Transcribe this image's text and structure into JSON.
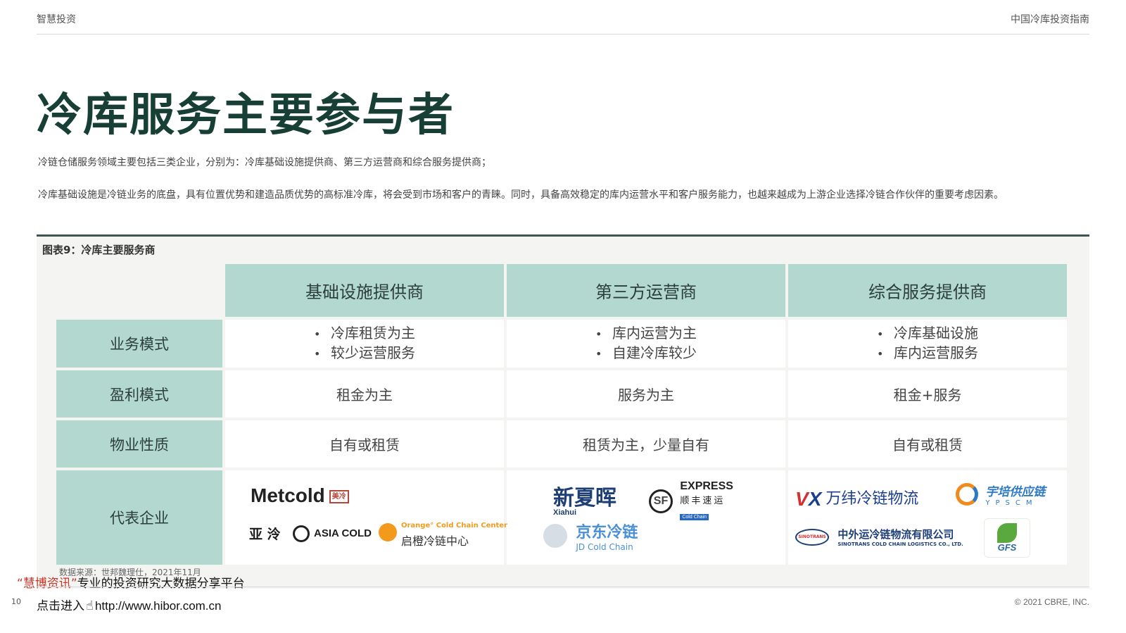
{
  "header": {
    "left": "智慧投资",
    "right": "中国冷库投资指南"
  },
  "title": "冷库服务主要参与者",
  "intro": {
    "p1": "冷链仓储服务领域主要包括三类企业，分别为：冷库基础设施提供商、第三方运营商和综合服务提供商；",
    "p2": "冷库基础设施是冷链业务的底盘，具有位置优势和建造品质优势的高标准冷库，将会受到市场和客户的青睐。同时，具备高效稳定的库内运营水平和客户服务能力，也越来越成为上游企业选择冷链合作伙伴的重要考虑因素。"
  },
  "figure": {
    "caption": "图表9：冷库主要服务商",
    "columns": [
      "基础设施提供商",
      "第三方运营商",
      "综合服务提供商"
    ],
    "rows": [
      {
        "label": "业务模式",
        "cells": [
          [
            "冷库租赁为主",
            "较少运营服务"
          ],
          [
            "库内运营为主",
            "自建冷库较少"
          ],
          [
            "冷库基础设施",
            "库内运营服务"
          ]
        ]
      },
      {
        "label": "盈利模式",
        "cells": [
          "租金为主",
          "服务为主",
          "租金+服务"
        ]
      },
      {
        "label": "物业性质",
        "cells": [
          "自有或租赁",
          "租赁为主，少量自有",
          "自有或租赁"
        ]
      },
      {
        "label": "代表企业"
      }
    ],
    "logos": {
      "metcold": {
        "name": "Metcold",
        "seal": "美冷"
      },
      "yaleng": {
        "name": "亚 泠"
      },
      "asiacold": {
        "name": "ASIA COLD"
      },
      "orange": {
        "en": "Orange° Cold Chain Center",
        "zh": "启橙冷链中心"
      },
      "xiahui": {
        "name": "新夏晖",
        "sub": "Xiahui"
      },
      "sf": {
        "mark": "SF",
        "en": "EXPRESS",
        "zh": "顺丰速运",
        "badge": "Cold Chain"
      },
      "jd": {
        "zh": "京东冷链",
        "en": "JD Cold Chain"
      },
      "vx": {
        "mark_v": "V",
        "mark_x": "X",
        "zh": "万纬冷链物流"
      },
      "ypscm": {
        "zh": "宇培供应链",
        "en": "YPSCM"
      },
      "sinotrans": {
        "mark": "SINOTRANS",
        "zh": "中外运冷链物流有限公司",
        "en": "SINOTRANS COLD CHAIN LOGISTICS CO., LTD."
      },
      "gfs": {
        "name": "GFS"
      }
    },
    "source": "数据来源：世邦魏理仕，2021年11月"
  },
  "watermark": {
    "brand": "慧博资讯",
    "slogan": "专业的投资研究大数据分享平台",
    "click": "点击进入",
    "url": "http://www.hibor.com.cn"
  },
  "footer": {
    "page": "10",
    "copyright": "© 2021 CBRE, INC."
  },
  "colors": {
    "accent": "#b2d8cf",
    "title": "#173f35",
    "rule": "#3e5553"
  }
}
